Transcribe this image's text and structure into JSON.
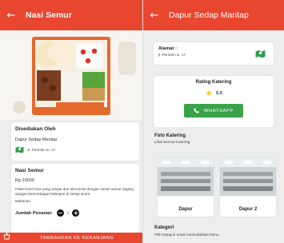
{
  "left": {
    "title": "Nasi Semur",
    "provider": {
      "heading": "Disediakan Oleh",
      "name": "Dapur Sedap Mantap",
      "address": "Jl. Perintis no. 17",
      "icon": "map-icon"
    },
    "menu": {
      "name": "Nasi Semur",
      "price": "Rp.10000",
      "description": "Paket lunch box yang simple dan ekonomis dengan varian semur daging sangat ideal sebagai hidangan di setiap acara",
      "category": "Makanan",
      "quantity_label": "Jumlah Pesanan",
      "quantity": "1",
      "minus": "−",
      "plus": "+"
    },
    "cart_button": "TAMBAHKAN KE KERANJANG"
  },
  "right": {
    "title": "Dapur Sedap Mantap",
    "address_label": "Alamat :",
    "address": "jl. Perintis no. 17",
    "rating_label": "Rating Katering",
    "rating": "5.0",
    "whatsapp": "WHATSAPP",
    "photos_heading": "Foto Katering",
    "photos_sub": "Lihat Semua Katering",
    "photos": [
      "Dapur",
      "Dapur 2"
    ],
    "category_heading": "Kategori",
    "category_sub": "Pilih kategori untuk memudahkan kamu."
  },
  "colors": {
    "appbar": "#e8462f",
    "whatsapp": "#3aa34a",
    "map": "#2e9b48",
    "star": "#f3c623"
  }
}
